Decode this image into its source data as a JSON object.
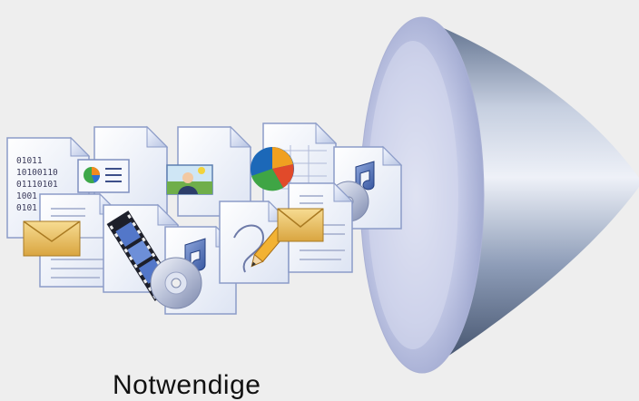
{
  "caption": "Notwendige",
  "binary_lines": [
    "01011",
    "10100110",
    "01110101",
    "1001",
    "0101"
  ],
  "icons": [
    "binary-file-icon",
    "presentation-file-icon",
    "image-file-icon",
    "spreadsheet-file-icon",
    "pie-chart-icon",
    "audio-file-icon",
    "email-file-icon",
    "video-file-icon",
    "music-cd-file-icon",
    "drawing-file-icon",
    "email-document-icon",
    "funnel-cone"
  ],
  "colors": {
    "background": "#eeeeee",
    "page_border": "#8c9cc8",
    "cone_light": "#cfd6ea",
    "cone_dark": "#4a5c78"
  }
}
